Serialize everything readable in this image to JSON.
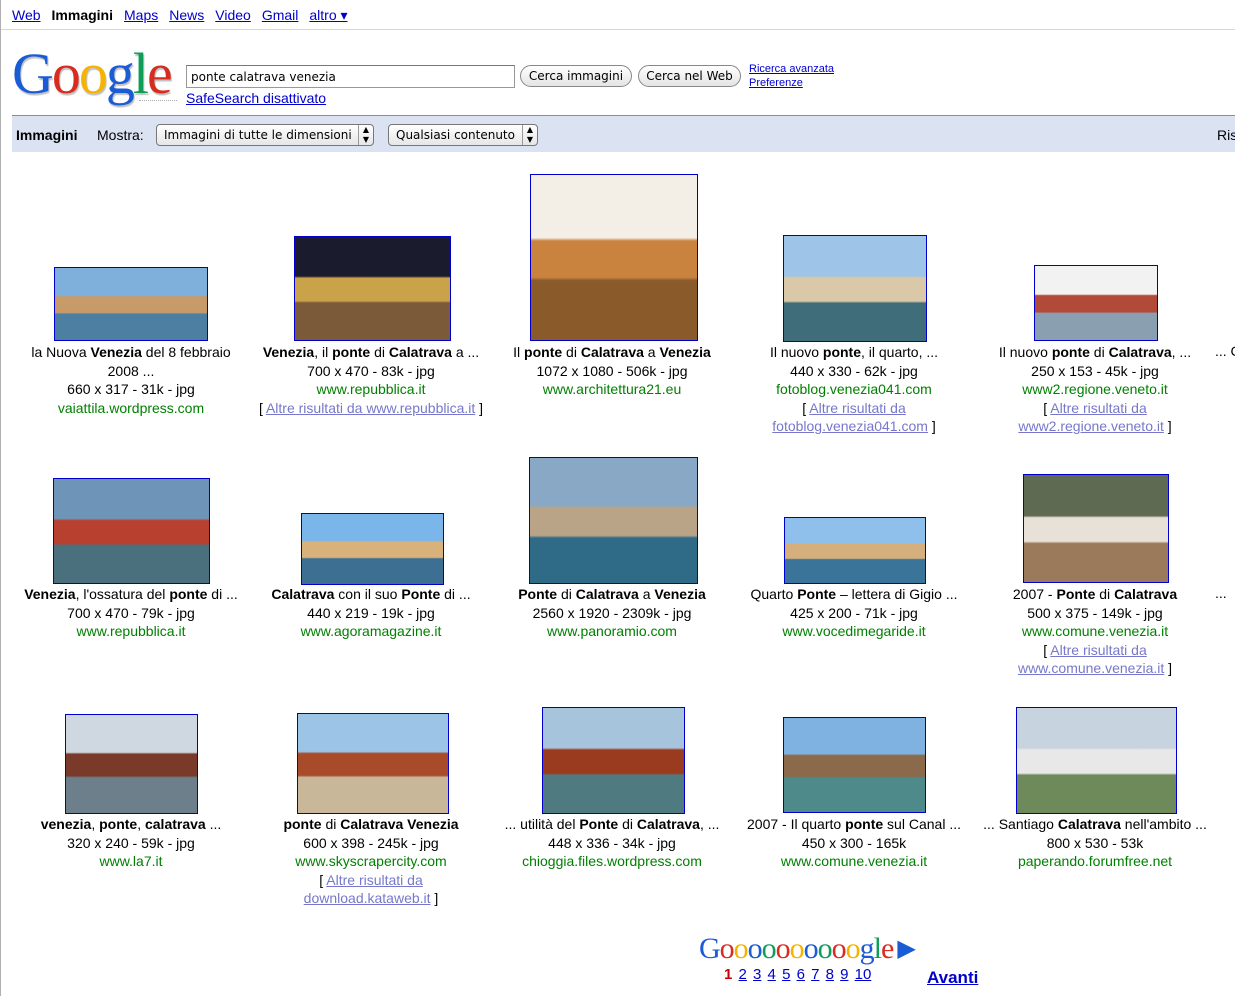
{
  "nav": {
    "items": [
      "Web",
      "Immagini",
      "Maps",
      "News",
      "Video",
      "Gmail"
    ],
    "current": "Immagini",
    "more": "altro ▾"
  },
  "logo_letters": [
    {
      "ch": "G",
      "color": "#1a5bd6"
    },
    {
      "ch": "o",
      "color": "#d62d20"
    },
    {
      "ch": "o",
      "color": "#f4b400"
    },
    {
      "ch": "g",
      "color": "#1a5bd6"
    },
    {
      "ch": "l",
      "color": "#0f9d58"
    },
    {
      "ch": "e",
      "color": "#d62d20"
    }
  ],
  "search": {
    "query": "ponte calatrava venezia",
    "btn_images": "Cerca immagini",
    "btn_web": "Cerca nel Web",
    "advanced": "Ricerca avanzata",
    "preferences": "Preferenze",
    "safesearch": "SafeSearch disattivato"
  },
  "bar": {
    "title": "Immagini",
    "show_label": "Mostra:",
    "size_option": "Immagini di tutte le dimensioni",
    "content_option": "Qualsiasi contenuto",
    "results_truncated": "Ris"
  },
  "rows": [
    [
      {
        "cap1": "la Nuova <b>Venezia</b> del 8 febbraio",
        "cap2": "2008 ...",
        "dim": "660 x 317 - 31k - jpg",
        "host": "vaiattila.wordpress.com",
        "more": null
      },
      {
        "cap1": "<b>Venezia</b>, il <b>ponte</b> di <b>Calatrava</b> a ...",
        "cap2": null,
        "dim": "700 x 470 - 83k - jpg",
        "host": "www.repubblica.it",
        "more": [
          "Altre risultati da www.repubblica.it"
        ]
      },
      {
        "cap1": "Il <b>ponte</b> di <b>Calatrava</b> a <b>Venezia</b>",
        "cap2": null,
        "dim": "1072 x 1080 - 506k - jpg",
        "host": "www.architettura21.eu",
        "more": null
      },
      {
        "cap1": "Il nuovo <b>ponte</b>, il quarto, ...",
        "cap2": null,
        "dim": "440 x 330 - 62k - jpg",
        "host": "fotoblog.venezia041.com",
        "more": [
          "Altre risultati da",
          "fotoblog.venezia041.com"
        ]
      },
      {
        "cap1": "Il nuovo <b>ponte</b> di <b>Calatrava</b>, ...",
        "cap2": null,
        "dim": "250 x 153 - 45k - jpg",
        "host": "www2.regione.veneto.it",
        "more": [
          "Altre risultati da",
          "www2.regione.veneto.it"
        ]
      }
    ],
    [
      {
        "cap1": "<b>Venezia</b>, l'ossatura del <b>ponte</b> di ...",
        "cap2": null,
        "dim": "700 x 470 - 79k - jpg",
        "host": "www.repubblica.it",
        "more": null
      },
      {
        "cap1": "<b>Calatrava</b> con il suo <b>Ponte</b> di ...",
        "cap2": null,
        "dim": "440 x 219 - 19k - jpg",
        "host": "www.agoramagazine.it",
        "more": null
      },
      {
        "cap1": "<b>Ponte</b> di <b>Calatrava</b> a <b>Venezia</b>",
        "cap2": null,
        "dim": "2560 x 1920 - 2309k - jpg",
        "host": "www.panoramio.com",
        "more": null
      },
      {
        "cap1": "Quarto <b>Ponte</b> – lettera di Gigio ...",
        "cap2": null,
        "dim": "425 x 200 - 71k - jpg",
        "host": "www.vocedimegaride.it",
        "more": null
      },
      {
        "cap1": "2007 - <b>Ponte</b> di <b>Calatrava</b>",
        "cap2": null,
        "dim": "500 x 375 - 149k - jpg",
        "host": "www.comune.venezia.it",
        "more": [
          "Altre risultati da",
          "www.comune.venezia.it"
        ]
      }
    ],
    [
      {
        "cap1": "<b>venezia</b>, <b>ponte</b>, <b>calatrava</b> ...",
        "cap2": null,
        "dim": "320 x 240 - 59k - jpg",
        "host": "www.la7.it",
        "more": null
      },
      {
        "cap1": "<b>ponte</b> di <b>Calatrava Venezia</b>",
        "cap2": null,
        "dim": "600 x 398 - 245k - jpg",
        "host": "www.skyscrapercity.com",
        "more": [
          "Altre risultati da",
          "download.kataweb.it"
        ]
      },
      {
        "cap1": "... utilità del <b>Ponte</b> di <b>Calatrava</b>, ...",
        "cap2": null,
        "dim": "448 x 336 - 34k - jpg",
        "host": "chioggia.files.wordpress.com",
        "more": null
      },
      {
        "cap1": "2007 - Il quarto <b>ponte</b> sul Canal ...",
        "cap2": null,
        "dim": "450 x 300 - 165k",
        "host": "www.comune.venezia.it",
        "more": null
      },
      {
        "cap1": "... Santiago <b>Calatrava</b> nell'ambito ...",
        "cap2": null,
        "dim": "800 x 530 - 53k",
        "host": "paperando.forumfree.net",
        "more": null
      }
    ]
  ],
  "edge": [
    "... C",
    "...",
    ""
  ],
  "pager": {
    "letters": [
      {
        "ch": "G",
        "color": "#1a5bd6"
      },
      {
        "ch": "o",
        "color": "#d62d20"
      },
      {
        "ch": "o",
        "color": "#f4b400"
      },
      {
        "ch": "o",
        "color": "#1a5bd6"
      },
      {
        "ch": "o",
        "color": "#0f9d58"
      },
      {
        "ch": "o",
        "color": "#d62d20"
      },
      {
        "ch": "o",
        "color": "#f4b400"
      },
      {
        "ch": "o",
        "color": "#1a5bd6"
      },
      {
        "ch": "o",
        "color": "#0f9d58"
      },
      {
        "ch": "o",
        "color": "#d62d20"
      },
      {
        "ch": "o",
        "color": "#f4b400"
      },
      {
        "ch": "g",
        "color": "#1a5bd6"
      },
      {
        "ch": "l",
        "color": "#0f9d58"
      },
      {
        "ch": "e",
        "color": "#d62d20"
      }
    ],
    "pages": [
      "1",
      "2",
      "3",
      "4",
      "5",
      "6",
      "7",
      "8",
      "9",
      "10"
    ],
    "current": "1",
    "next": "Avanti"
  }
}
